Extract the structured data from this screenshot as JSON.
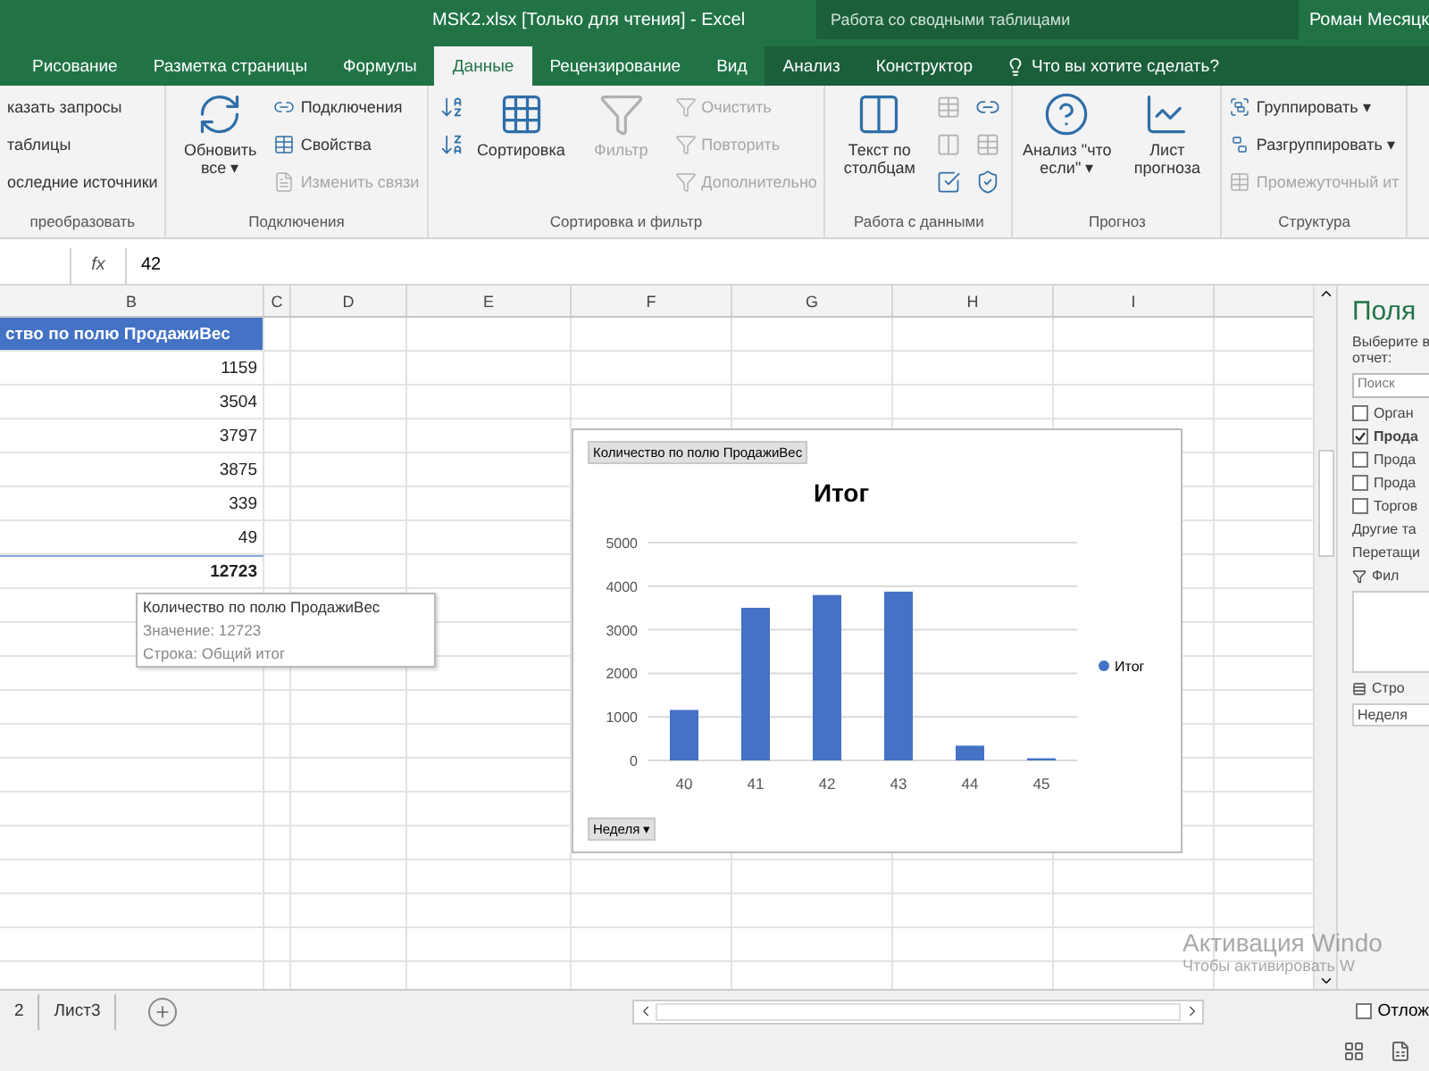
{
  "window": {
    "title": "MSK2.xlsx [Только для чтения] - Excel",
    "context_title": "Работа со сводными таблицами",
    "user": "Роман Месяцк"
  },
  "tabs": [
    {
      "label": "Рисование",
      "selected": false,
      "context": false
    },
    {
      "label": "Разметка страницы",
      "selected": false,
      "context": false
    },
    {
      "label": "Формулы",
      "selected": false,
      "context": false
    },
    {
      "label": "Данные",
      "selected": true,
      "context": false
    },
    {
      "label": "Рецензирование",
      "selected": false,
      "context": false
    },
    {
      "label": "Вид",
      "selected": false,
      "context": false
    },
    {
      "label": "Анализ",
      "selected": false,
      "context": true
    },
    {
      "label": "Конструктор",
      "selected": false,
      "context": true
    }
  ],
  "tell_me": {
    "placeholder": "Что вы хотите сделать?"
  },
  "ribbon": {
    "groups": [
      {
        "label": "преобразовать",
        "columns": [
          [
            {
              "kind": "small",
              "text": "казать запросы",
              "disabled": false
            },
            {
              "kind": "small",
              "text": "таблицы",
              "disabled": false
            },
            {
              "kind": "small",
              "text": "оследние источники",
              "disabled": false
            }
          ]
        ]
      },
      {
        "label": "Подключения",
        "columns": [
          [
            {
              "kind": "large",
              "text": "Обновить все ▾",
              "disabled": false
            }
          ],
          [
            {
              "kind": "small",
              "text": "Подключения",
              "disabled": false
            },
            {
              "kind": "small",
              "text": "Свойства",
              "disabled": false
            },
            {
              "kind": "small",
              "text": "Изменить связи",
              "disabled": true
            }
          ]
        ]
      },
      {
        "label": "Сортировка и фильтр",
        "columns": [
          [
            {
              "kind": "icon",
              "disabled": false
            },
            {
              "kind": "icon",
              "disabled": false
            }
          ],
          [
            {
              "kind": "large",
              "text": "Сортировка",
              "disabled": false
            }
          ],
          [
            {
              "kind": "large",
              "text": "Фильтр",
              "disabled": true
            }
          ],
          [
            {
              "kind": "small",
              "text": "Очистить",
              "disabled": true
            },
            {
              "kind": "small",
              "text": "Повторить",
              "disabled": true
            },
            {
              "kind": "small",
              "text": "Дополнительно",
              "disabled": true
            }
          ]
        ]
      },
      {
        "label": "Работа с данными",
        "columns": [
          [
            {
              "kind": "large",
              "text": "Текст по столбцам",
              "disabled": false
            }
          ],
          [
            {
              "kind": "icon",
              "disabled": true
            },
            {
              "kind": "icon",
              "disabled": true
            },
            {
              "kind": "icon",
              "disabled": false
            }
          ],
          [
            {
              "kind": "icon",
              "disabled": false
            },
            {
              "kind": "icon",
              "disabled": true
            },
            {
              "kind": "icon",
              "disabled": false
            }
          ]
        ]
      },
      {
        "label": "Прогноз",
        "columns": [
          [
            {
              "kind": "large",
              "text": "Анализ \"что если\" ▾",
              "disabled": false
            }
          ],
          [
            {
              "kind": "large",
              "text": "Лист прогноза",
              "disabled": false
            }
          ]
        ]
      },
      {
        "label": "Структура",
        "columns": [
          [
            {
              "kind": "small",
              "text": "Группировать ▾",
              "disabled": false
            },
            {
              "kind": "small",
              "text": "Разгруппировать ▾",
              "disabled": false
            },
            {
              "kind": "small",
              "text": "Промежуточный ит",
              "disabled": true
            }
          ]
        ]
      }
    ]
  },
  "formula_bar": {
    "fx": "fx",
    "value": "42"
  },
  "columns": [
    "B",
    "C",
    "D",
    "E",
    "F",
    "G",
    "H",
    "I"
  ],
  "pivot": {
    "header": "ство по полю ПродажиВес",
    "values": [
      "1159",
      "3504",
      "3797",
      "3875",
      "339",
      "49"
    ],
    "total": "12723"
  },
  "tooltip": {
    "title": "Количество по полю ПродажиВес",
    "value": "Значение: 12723",
    "row": "Строка: Общий итог"
  },
  "chart": {
    "field_button": "Количество по полю ПродажиВес",
    "axis_button": "Неделя ▾",
    "chart_data": {
      "type": "bar",
      "title": "Итог",
      "categories": [
        "40",
        "41",
        "42",
        "43",
        "44",
        "45"
      ],
      "series": [
        {
          "name": "Итог",
          "color": "#4472c4",
          "values": [
            1159,
            3504,
            3797,
            3875,
            339,
            49
          ]
        }
      ],
      "grid": true,
      "ylim": [
        0,
        5000
      ],
      "yticks": [
        0,
        1000,
        2000,
        3000,
        4000,
        5000
      ]
    }
  },
  "task_pane": {
    "title": "Поля",
    "hint": "Выберите в отчет:",
    "search": {
      "placeholder": "Поиск"
    },
    "fields": [
      {
        "label": "Орган",
        "checked": false
      },
      {
        "label": "Прода",
        "checked": true
      },
      {
        "label": "Прода",
        "checked": false
      },
      {
        "label": "Прода",
        "checked": false
      },
      {
        "label": "Торгов",
        "checked": false
      }
    ],
    "more": "Другие та",
    "drag": "Перетащи",
    "filters": "Фил",
    "rows": "Стро",
    "row_item": "Неделя",
    "defer": {
      "label": "Отлож",
      "checked": false
    }
  },
  "sheets": [
    {
      "label": "2",
      "selected": false
    },
    {
      "label": "Лист3",
      "selected": false
    }
  ],
  "os_overlay": [
    "Активация Windo",
    "Чтобы активировать W"
  ]
}
